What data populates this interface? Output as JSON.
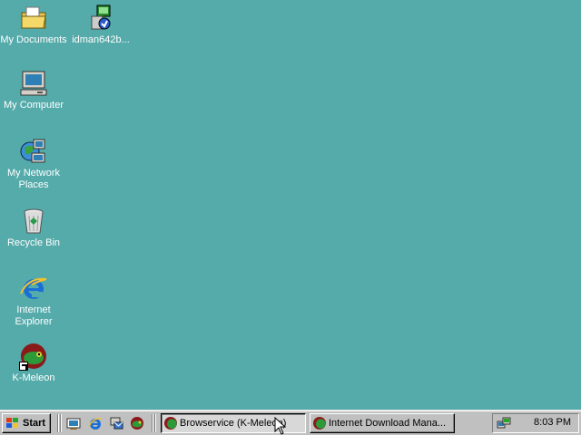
{
  "desktop": {
    "background_color": "#55aaaa",
    "icons": [
      {
        "label": "My Documents",
        "icon": "folder-icon"
      },
      {
        "label": "idman642b...",
        "icon": "installer-icon"
      },
      {
        "label": "My Computer",
        "icon": "computer-icon"
      },
      {
        "label": "My Network Places",
        "icon": "network-icon"
      },
      {
        "label": "Recycle Bin",
        "icon": "recycle-bin-icon"
      },
      {
        "label": "Internet Explorer",
        "icon": "internet-explorer-icon"
      },
      {
        "label": "K-Meleon",
        "icon": "k-meleon-icon"
      }
    ]
  },
  "taskbar": {
    "start_label": "Start",
    "quick_launch": [
      "show-desktop-icon",
      "internet-explorer-icon",
      "outlook-express-icon",
      "k-meleon-icon"
    ],
    "tasks": [
      {
        "label": "Browservice (K-Meleon)",
        "active": true
      },
      {
        "label": "Internet Download Mana...",
        "active": false
      }
    ],
    "tray": {
      "clock": "8:03 PM",
      "icon": "network-tray-icon"
    }
  }
}
